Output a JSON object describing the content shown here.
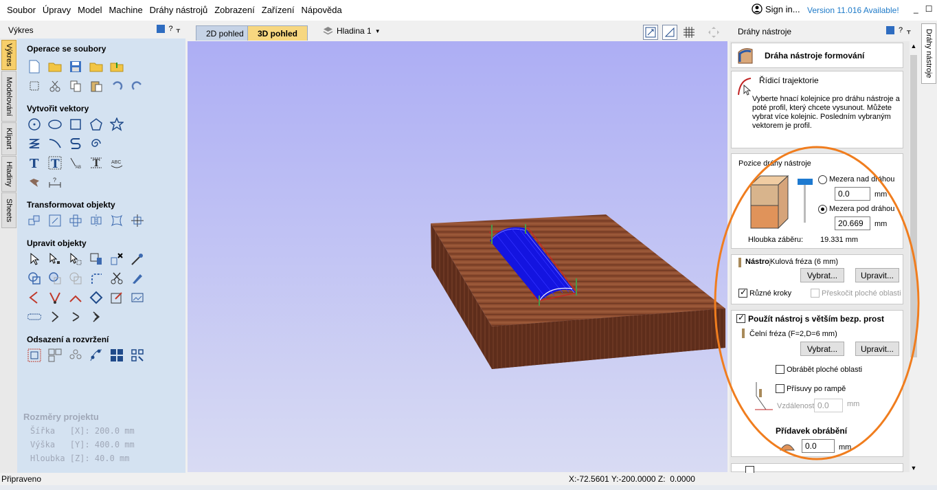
{
  "menubar": {
    "items": [
      "Soubor",
      "Úpravy",
      "Model",
      "Machine",
      "Dráhy nástrojů",
      "Zobrazení",
      "Zařízení",
      "Nápověda"
    ],
    "signin": "Sign in...",
    "version": "Version 11.016 Available!",
    "min": "_",
    "restore": "☐",
    "close": "✕"
  },
  "left": {
    "title": "Výkres",
    "tabs": [
      "Výkres",
      "Modelování",
      "Klipart",
      "Hladiny",
      "Sheets"
    ],
    "sections": {
      "files": "Operace se soubory",
      "vectors": "Vytvořit vektory",
      "transform": "Transformovat objekty",
      "edit": "Upravit objekty",
      "offset": "Odsazení a rozvržení"
    },
    "project": {
      "heading": "Rozměry projektu",
      "width": "Šířka   [X]: 200.0 mm",
      "height": "Výška   [Y]: 400.0 mm",
      "depth": "Hloubka [Z]: 40.0 mm"
    }
  },
  "center": {
    "tab2d": "2D pohled",
    "tab3d": "3D pohled",
    "layer": "Hladina 1"
  },
  "right": {
    "title": "Dráhy nástroje",
    "vtab": "Dráhy nástroje",
    "header": "Dráha nástroje formování",
    "rail": {
      "label": "Řídicí trajektorie",
      "help": "Vyberte hnací kolejnice pro dráhu nástroje a poté profil, který chcete vysunout. Můžete vybrat více kolejnic. Posledním vybraným vektorem je profil."
    },
    "position": {
      "label": "Pozice dráhy nástroje",
      "above": "Mezera nad dráhou",
      "above_val": "0.0",
      "below": "Mezera pod dráhou",
      "below_val": "20.669",
      "unit": "mm",
      "depth_label": "Hloubka záběru:",
      "depth_val": "19.331 mm"
    },
    "tool": {
      "label": "Nástroj",
      "name": "Kulová fréza (6 mm)",
      "select": "Vybrat...",
      "edit": "Upravit...",
      "steps": "Různé kroky",
      "skip": "Přeskočit ploché oblasti"
    },
    "bigtool": {
      "label": "Použít nástroj s větším bezp. prost",
      "name": "Čelní fréza (F=2,D=6 mm)",
      "select": "Vybrat...",
      "edit": "Upravit...",
      "flat": "Obrábět ploché oblasti",
      "ramp": "Přísuvy po rampě",
      "dist": "Vzdálenost",
      "dist_val": "0.0",
      "unit": "mm"
    },
    "allowance": {
      "label": "Přídavek obrábění",
      "value": "0.0",
      "unit": "mm"
    }
  },
  "status": {
    "ready": "Připraveno",
    "coords": "X:-72.5601 Y:-200.0000 Z:  0.0000"
  }
}
